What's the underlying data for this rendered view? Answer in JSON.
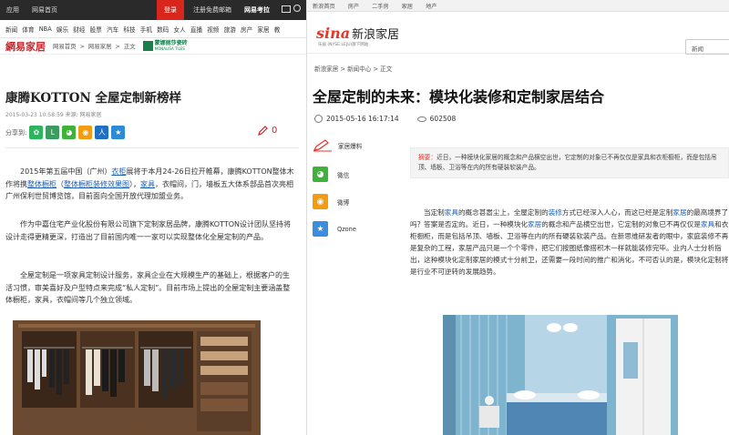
{
  "left": {
    "topbar": {
      "app": "应用",
      "home": "网易首页",
      "login": "登录",
      "register": "注册免费邮箱",
      "kaoyou": "网易考拉"
    },
    "nav": [
      "新闻",
      "体育",
      "NBA",
      "娱乐",
      "财经",
      "股票",
      "汽车",
      "科技",
      "手机",
      "数码",
      "女人",
      "直播",
      "视频",
      "旅游",
      "房产",
      "家居",
      "教"
    ],
    "brand": {
      "logo": "網易家居",
      "bc1": "网易首页",
      "bc2": "网易家居",
      "bc3": "正文",
      "sponsor": "蒙娜丽莎瓷砖",
      "sponsor_en": "MONALISA TILES"
    },
    "article": {
      "title": "康腾KOTTON 全屋定制新榜样",
      "meta": "2015-03-23 10:58:59  来源: 网易家居",
      "share_label": "分享到:",
      "comment_count": "0",
      "p1": {
        "a": "2015年第五届中国（广州）",
        "b": "衣柜",
        "c": "展将于本月24-26日拉开帷幕，康腾KOTTON整体木作将携",
        "d": "整体橱柜",
        "e": "（",
        "f": "整体橱柜装修效果图",
        "g": "），",
        "h": "家具",
        "i": "，衣帽间，门，墙板五大体系部品首次亮相广州保利世贸博览馆，目前面向全国开放代理加盟业务。"
      },
      "p2": "作为中嘉住宅产业化股份有限公司旗下定制家居品牌，康腾KOTTON设计团队坚持将设计走得更精更深，打造出了目前国内唯一一家可以实现整体化全屋定制的产品。",
      "p3": "全屋定制是一项家具定制设计服务，家具企业在大规模生产的基础上，根据客户的生活习惯，审美喜好及户型特点来完成“私人定制”。目前市场上提出的全屋定制主要涵盖整体橱柜，家具，衣帽间等几个独立领域。"
    }
  },
  "right": {
    "topbar": [
      "新浪首页",
      "房产",
      "二手房",
      "家居",
      "地产"
    ],
    "logo": {
      "sina": "sina",
      "name": "新浪家居",
      "sub": "乐居 (NYSE:LEJU)旗下网站"
    },
    "search_value": "新闻",
    "breadcrumb": "新浪家居  >  新闻中心  >  正文",
    "title": "全屋定制的未来：模块化装修和定制家居结合",
    "datetime": "2015-05-16 16:17:14",
    "views": "602508",
    "side": {
      "report": "家居爆料",
      "wechat": "微信",
      "weibo": "微博",
      "qzone": "Qzone"
    },
    "summary_label": "摘要：",
    "summary": "近日，一种模块化家居的概念和产品横空出世，它定制的对象已不再仅仅是家具和衣柜橱柜，而是包括吊顶、墙板、卫浴等在内的所有硬装软装产品。",
    "body": {
      "a": "当定制",
      "b": "家具",
      "c": "的概念甚嚣尘上，全屋定制的",
      "d": "装修",
      "e": "方式已经深入人心，而这已经是定制",
      "f": "家居",
      "g": "的最高境界了吗？答案是否定的。近日，一种模块化",
      "h": "家居",
      "i": "的概念和产品横空出世，它定制的对象已不再仅仅是",
      "j": "家具",
      "k": "和衣柜橱柜，而是包括吊顶、墙板、卫浴等在内的所有硬装软装产品。在新思维研发者的眼中，家庭装修不再是复杂的工程，家居产品只是一个个零件，把它们按图纸像搭积木一样就能装修完毕。业内人士分析指出，这种模块化定制家居的模式十分前卫，还需要一段时间的推广和消化，不可否认的是，模块化定制将是行业不可逆转的发展趋势。"
    }
  }
}
